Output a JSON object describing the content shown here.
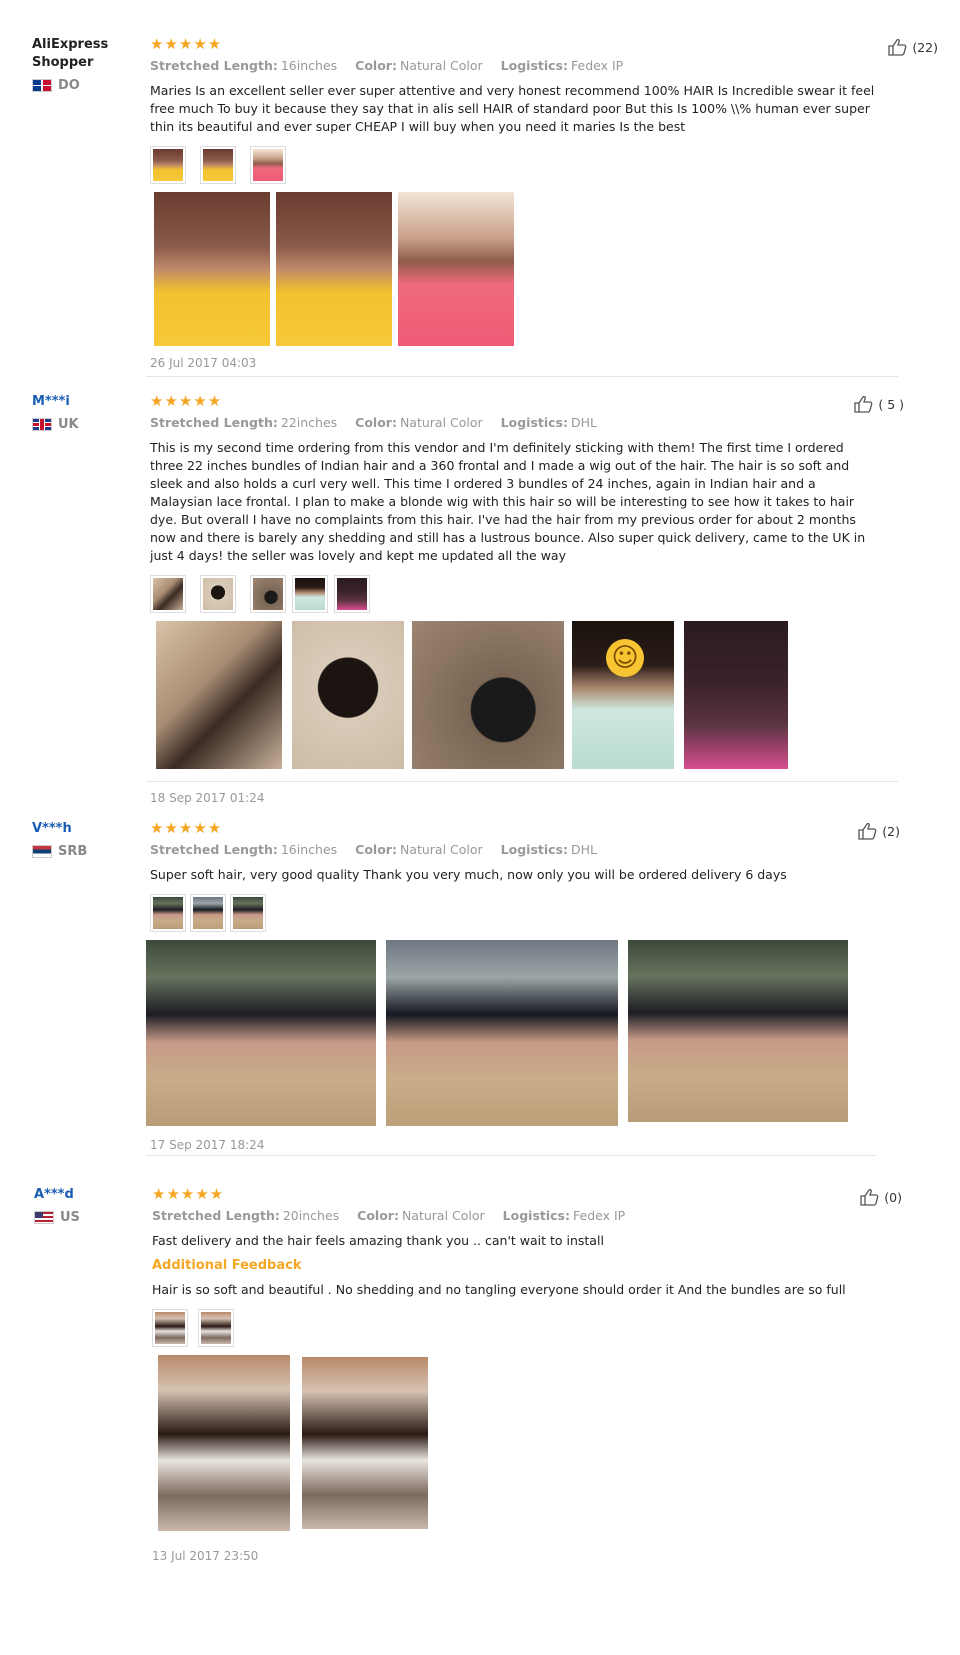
{
  "reviews": [
    {
      "user": "AliExpress Shopper",
      "country": "DO",
      "stars": "★★★★★",
      "length_label": "Stretched Length:",
      "length": "16inches",
      "color_label": "Color:",
      "color": "Natural Color",
      "logistics_label": "Logistics:",
      "logistics": "Fedex IP",
      "text": "Maries Is an excellent seller ever super attentive and very honest recommend 100% HAIR Is Incredible swear it feel free much To buy it because they say that in alis sell HAIR of standard poor But this Is 100% \\\\% human ever super thin its beautiful and ever super CHEAP I will buy when you need it maries Is the best",
      "date": "26 Jul 2017 04:03",
      "helpful": "(22)"
    },
    {
      "user": "M***i",
      "country": "UK",
      "stars": "★★★★★",
      "length_label": "Stretched Length:",
      "length": "22inches",
      "color_label": "Color:",
      "color": "Natural Color",
      "logistics_label": "Logistics:",
      "logistics": "DHL",
      "text": "This is my second time ordering from this vendor and I'm definitely sticking with them! The first time I ordered three 22 inches bundles of Indian hair and a 360 frontal and I made a wig out of the hair. The hair is so soft and sleek and also holds a curl very well. This time I ordered 3 bundles of 24 inches, again in Indian hair and a Malaysian lace frontal. I plan to make a blonde wig with this hair so will be interesting to see how it takes to hair dye. But overall I have no complaints from this hair. I've had the hair from my previous order for about 2 months now and there is barely any shedding and still has a lustrous bounce. Also super quick delivery, came to the UK in just 4 days! the seller was lovely and kept me updated all the way",
      "date": "18 Sep 2017 01:24",
      "helpful": "( 5 )"
    },
    {
      "user": "V***h",
      "country": "SRB",
      "stars": "★★★★★",
      "length_label": "Stretched Length:",
      "length": "16inches",
      "color_label": "Color:",
      "color": "Natural Color",
      "logistics_label": "Logistics:",
      "logistics": "DHL",
      "text": "Super soft hair, very good quality Thank you very much, now only you will be ordered delivery 6 days",
      "date": "17 Sep 2017 18:24",
      "helpful": "(2)"
    },
    {
      "user": "A***d",
      "country": "US",
      "stars": "★★★★★",
      "length_label": "Stretched Length:",
      "length": "20inches",
      "color_label": "Color:",
      "color": "Natural Color",
      "logistics_label": "Logistics:",
      "logistics": "Fedex IP",
      "text": "Fast delivery and the hair feels amazing thank you .. can't wait to install",
      "additional_label": "Additional Feedback",
      "additional": "Hair is so soft and beautiful . No shedding and no tangling everyone should order it And the bundles are so full",
      "date": "13 Jul 2017 23:50",
      "helpful": "(0)"
    }
  ],
  "icons": {
    "helpful": "thumbs-up-icon",
    "stars": "star-icon"
  },
  "colors": {
    "accent": "#f5a623",
    "username": "#1a5db4"
  }
}
